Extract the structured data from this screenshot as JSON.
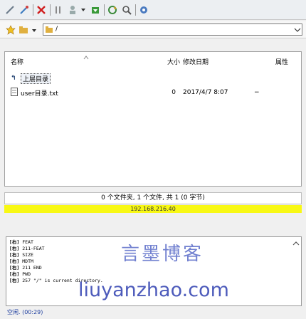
{
  "toolbar": {
    "icons": [
      "connect-icon",
      "disconnect-icon",
      "cancel-icon",
      "split-icon",
      "user-icon",
      "dropdown-arrow-icon",
      "refresh-icon",
      "sync-icon",
      "search-icon",
      "settings-icon"
    ]
  },
  "pathbar": {
    "path_value": "/"
  },
  "filelist": {
    "headers": {
      "name": "名称",
      "size": "大小",
      "date": "修改日期",
      "attr": "属性"
    },
    "parent_label": "上层目录",
    "files": [
      {
        "name": "user目录.txt",
        "size": "0",
        "date": "2017/4/7 8:07",
        "attr": "−"
      }
    ]
  },
  "status": {
    "summary": "0 个文件夹, 1 个文件, 共 1 (0 字节)",
    "host": "192.168.216.40"
  },
  "log": {
    "lines": [
      {
        "tag": "[右]",
        "text": "FEAT"
      },
      {
        "tag": "[右]",
        "text": "211-FEAT"
      },
      {
        "tag": "[右]",
        "text": "      SIZE"
      },
      {
        "tag": "[右]",
        "text": "      MDTM"
      },
      {
        "tag": "[右]",
        "text": "211 END"
      },
      {
        "tag": "[右]",
        "text": "PWD"
      },
      {
        "tag": "[右]",
        "text": "257 \"/\" is current directory."
      }
    ]
  },
  "watermark": {
    "line1": "言墨博客",
    "line2": "liuyanzhao.com"
  },
  "bottom": {
    "text": "空闲. (00:29)"
  },
  "colors": {
    "ip_bar": "#f8f814",
    "watermark": "#2f3fb0"
  }
}
